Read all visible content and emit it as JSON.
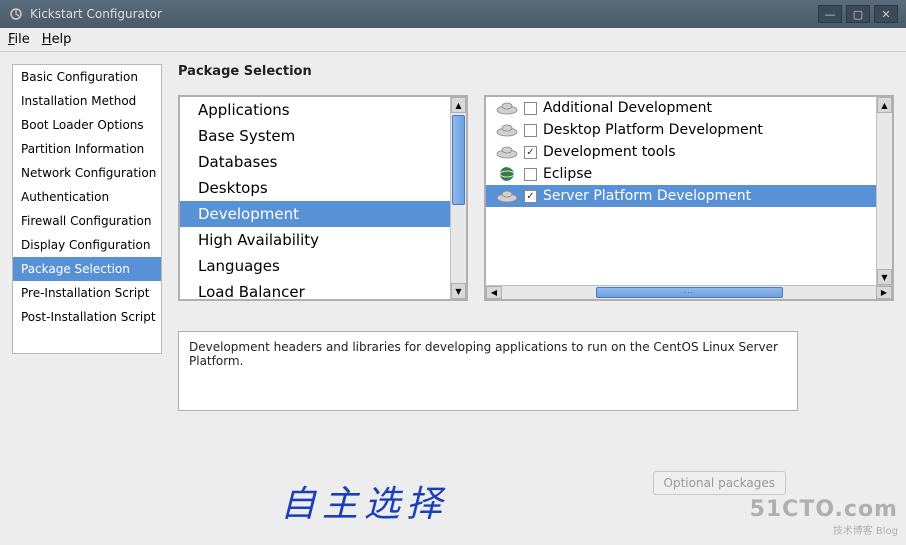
{
  "window": {
    "title": "Kickstart Configurator",
    "controls": {
      "minimize": "—",
      "maximize": "▢",
      "close": "✕"
    }
  },
  "menubar": {
    "file": "File",
    "help": "Help"
  },
  "sidebar": {
    "items": [
      {
        "label": "Basic Configuration",
        "selected": false
      },
      {
        "label": "Installation Method",
        "selected": false
      },
      {
        "label": "Boot Loader Options",
        "selected": false
      },
      {
        "label": "Partition Information",
        "selected": false
      },
      {
        "label": "Network Configuration",
        "selected": false
      },
      {
        "label": "Authentication",
        "selected": false
      },
      {
        "label": "Firewall Configuration",
        "selected": false
      },
      {
        "label": "Display Configuration",
        "selected": false
      },
      {
        "label": "Package Selection",
        "selected": true
      },
      {
        "label": "Pre-Installation Script",
        "selected": false
      },
      {
        "label": "Post-Installation Script",
        "selected": false
      }
    ]
  },
  "content": {
    "title": "Package Selection",
    "categories": [
      {
        "label": "Applications",
        "selected": false
      },
      {
        "label": "Base System",
        "selected": false
      },
      {
        "label": "Databases",
        "selected": false
      },
      {
        "label": "Desktops",
        "selected": false
      },
      {
        "label": "Development",
        "selected": true
      },
      {
        "label": "High Availability",
        "selected": false
      },
      {
        "label": "Languages",
        "selected": false
      },
      {
        "label": "Load Balancer",
        "selected": false
      }
    ],
    "packages": [
      {
        "label": "Additional Development",
        "checked": false,
        "selected": false,
        "icon": "hat"
      },
      {
        "label": "Desktop Platform Development",
        "checked": false,
        "selected": false,
        "icon": "hat"
      },
      {
        "label": "Development tools",
        "checked": true,
        "selected": false,
        "icon": "hat"
      },
      {
        "label": "Eclipse",
        "checked": false,
        "selected": false,
        "icon": "globe"
      },
      {
        "label": "Server Platform Development",
        "checked": true,
        "selected": true,
        "icon": "hat"
      }
    ],
    "description": "Development headers and libraries for developing applications to run on the CentOS Linux Server Platform.",
    "optional_button": "Optional packages"
  },
  "annotation": {
    "handwriting": "自主选择"
  },
  "watermark": {
    "site": "51CTO.com",
    "tagline": "技术博客  Blog"
  }
}
